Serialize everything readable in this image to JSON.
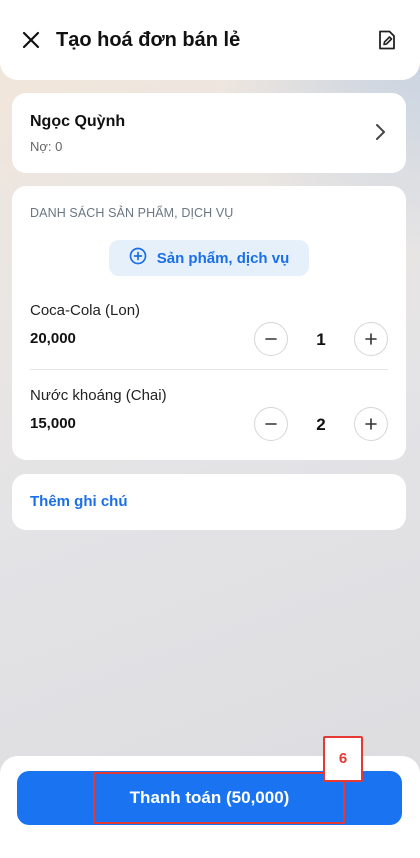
{
  "header": {
    "title": "Tạo hoá đơn bán lẻ",
    "close_icon": "close-icon",
    "edit_icon": "edit-document-icon"
  },
  "customer": {
    "name": "Ngọc Quỳnh",
    "debt": "Nợ: 0",
    "chevron_icon": "chevron-right-icon"
  },
  "products": {
    "section_title": "DANH SÁCH SẢN PHẨM, DỊCH VỤ",
    "add_label": "Sản phẩm, dịch vụ",
    "items": [
      {
        "name": "Coca-Cola (Lon)",
        "price": "20,000",
        "quantity": "1"
      },
      {
        "name": "Nước khoáng (Chai)",
        "price": "15,000",
        "quantity": "2"
      }
    ]
  },
  "note": {
    "label": "Thêm ghi chú"
  },
  "footer": {
    "pay_label": "Thanh toán (50,000)"
  },
  "annotation": {
    "marker": "6"
  },
  "colors": {
    "accent": "#1a73f0",
    "link": "#1a6fe8",
    "highlight": "#e53935"
  }
}
